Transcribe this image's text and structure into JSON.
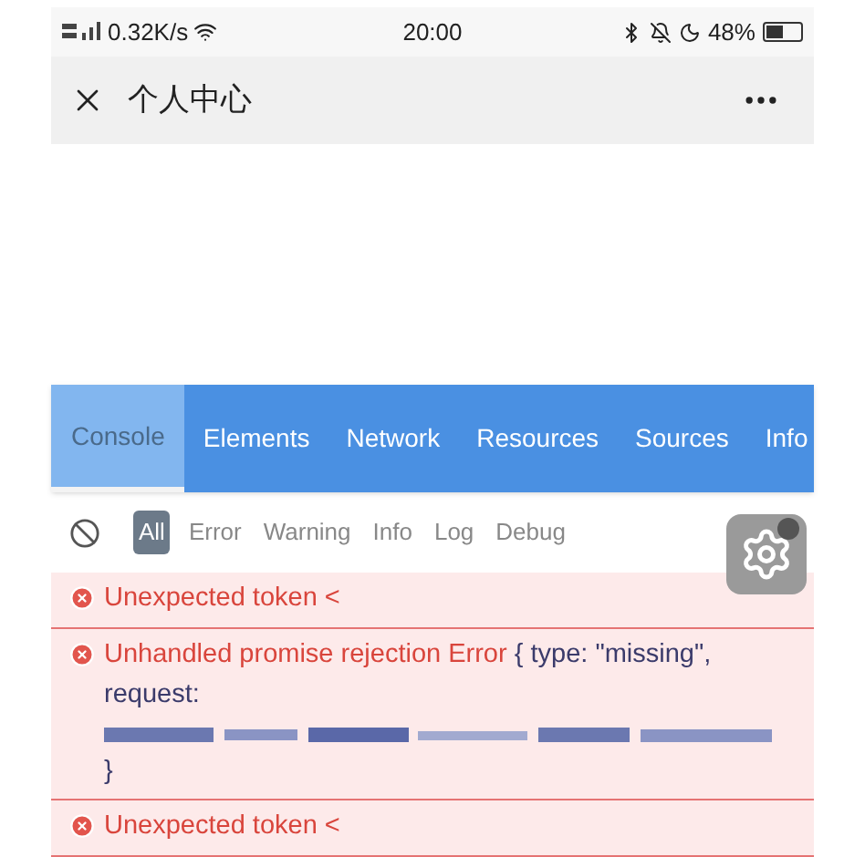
{
  "status_bar": {
    "network": "0.32K/s",
    "time": "20:00",
    "battery": "48%"
  },
  "nav": {
    "title": "个人中心"
  },
  "tabs": [
    {
      "label": "Console",
      "selected": true
    },
    {
      "label": "Elements",
      "selected": false
    },
    {
      "label": "Network",
      "selected": false
    },
    {
      "label": "Resources",
      "selected": false
    },
    {
      "label": "Sources",
      "selected": false
    },
    {
      "label": "Info",
      "selected": false
    }
  ],
  "filters": [
    {
      "label": "All",
      "selected": true
    },
    {
      "label": "Error",
      "selected": false
    },
    {
      "label": "Warning",
      "selected": false
    },
    {
      "label": "Info",
      "selected": false
    },
    {
      "label": "Log",
      "selected": false
    },
    {
      "label": "Debug",
      "selected": false
    }
  ],
  "logs": [
    {
      "message": "Unexpected token <"
    },
    {
      "message": "Unhandled promise rejection Error",
      "detail": "{ type: \"missing\", request:",
      "redacted": true,
      "closing": "}"
    },
    {
      "message": "Unexpected token <"
    }
  ]
}
